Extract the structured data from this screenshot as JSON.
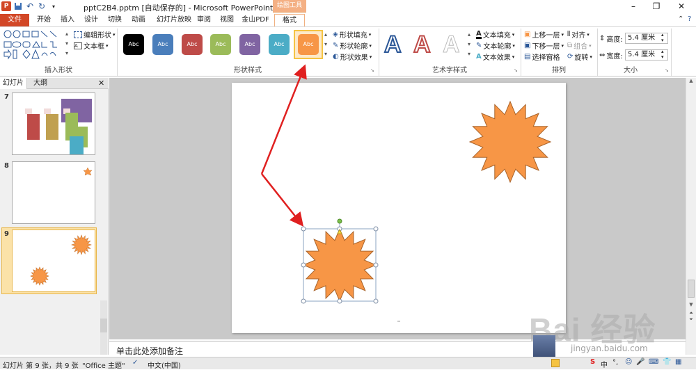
{
  "title_bar": {
    "window_title": "pptC2B4.pptm [自动保存的] - Microsoft PowerPoint",
    "context_header": "绘图工具"
  },
  "qat": {
    "undo": "↶",
    "redo": "↻"
  },
  "tabs": [
    "文件",
    "开始",
    "插入",
    "设计",
    "切换",
    "动画",
    "幻灯片放映",
    "审阅",
    "视图",
    "金山PDF",
    "格式"
  ],
  "ribbon": {
    "insert_shapes": {
      "label": "插入形状",
      "edit_shape": "编辑形状",
      "text_box": "文本框"
    },
    "shape_styles": {
      "label": "形状样式",
      "swatch_text": "Abc",
      "swatch_colors": [
        "#000000",
        "#4a7ebb",
        "#be4b48",
        "#9bbb59",
        "#8064a2",
        "#4bacc6",
        "#f79646"
      ],
      "fill": "形状填充",
      "outline": "形状轮廓",
      "effects": "形状效果"
    },
    "wordart": {
      "label": "艺术字样式",
      "text_fill": "文本填充",
      "text_outline": "文本轮廓",
      "text_effects": "文本效果",
      "letter": "A"
    },
    "arrange": {
      "label": "排列",
      "bring_forward": "上移一层",
      "send_backward": "下移一层",
      "selection_pane": "选择窗格",
      "align": "对齐",
      "group": "组合",
      "rotate": "旋转"
    },
    "size": {
      "label": "大小",
      "height_label": "高度:",
      "height_value": "5.4 厘米",
      "width_label": "宽度:",
      "width_value": "5.4 厘米"
    }
  },
  "side_panel": {
    "tab_slides": "幻灯片",
    "tab_outline": "大纲",
    "slide_numbers": [
      "7",
      "8",
      "9"
    ]
  },
  "notes": {
    "placeholder": "单击此处添加备注"
  },
  "status": {
    "slide_info": "幻灯片 第 9 张，共 9 张",
    "theme": "\"Office 主题\"",
    "language": "中文(中国)"
  },
  "watermark": {
    "text": "Bai 经验",
    "url": "jingyan.baidu.com"
  }
}
